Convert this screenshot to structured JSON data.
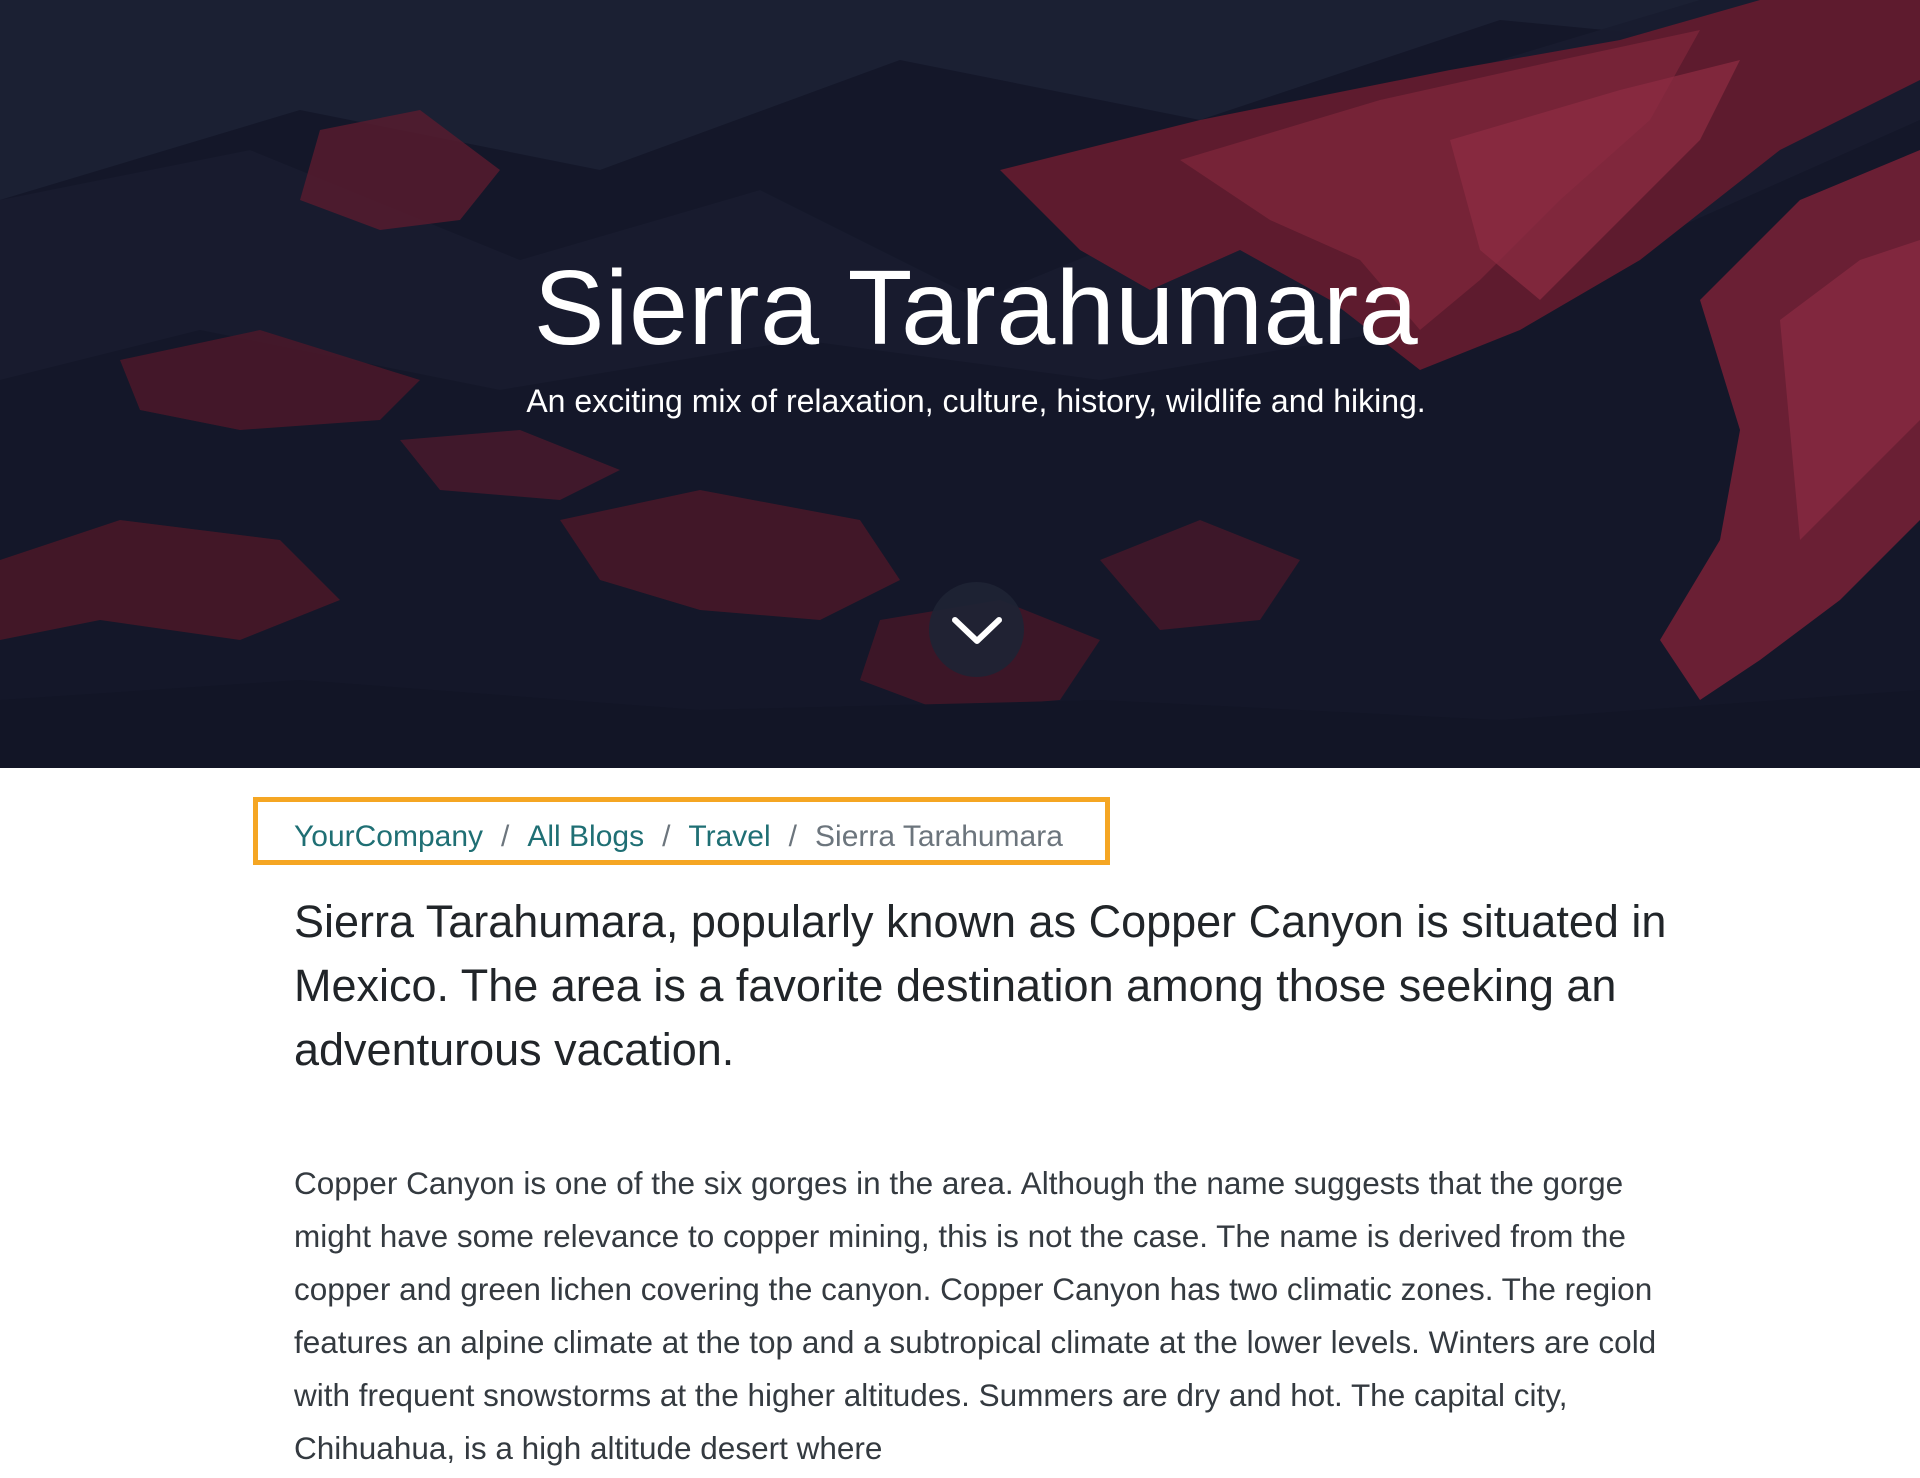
{
  "hero": {
    "title": "Sierra Tarahumara",
    "subtitle": "An exciting mix of relaxation, culture, history, wildlife and hiking.",
    "scroll_icon": "chevron-down-icon"
  },
  "breadcrumb": {
    "items": [
      {
        "label": "YourCompany"
      },
      {
        "label": "All Blogs"
      },
      {
        "label": "Travel"
      }
    ],
    "separator": "/",
    "current": "Sierra Tarahumara"
  },
  "article": {
    "lead": "Sierra Tarahumara, popularly known as Copper Canyon is situated in Mexico. The area is a favorite destination among those seeking an adventurous vacation.",
    "paragraph": "Copper Canyon is one of the six gorges in the area. Although the name suggests that the gorge might have some relevance to copper mining, this is not the case. The name is derived from the copper and green lichen covering the canyon. Copper Canyon has two climatic zones. The region features an alpine climate at the top and a subtropical climate at the lower levels. Winters are cold with frequent snowstorms at the higher altitudes. Summers are dry and hot. The capital city, Chihuahua, is a high altitude desert where"
  },
  "colors": {
    "hero_bg": "#131629",
    "mountain_red": "#6e1f33",
    "link": "#1f6f74",
    "highlight_border": "#f5a623"
  }
}
